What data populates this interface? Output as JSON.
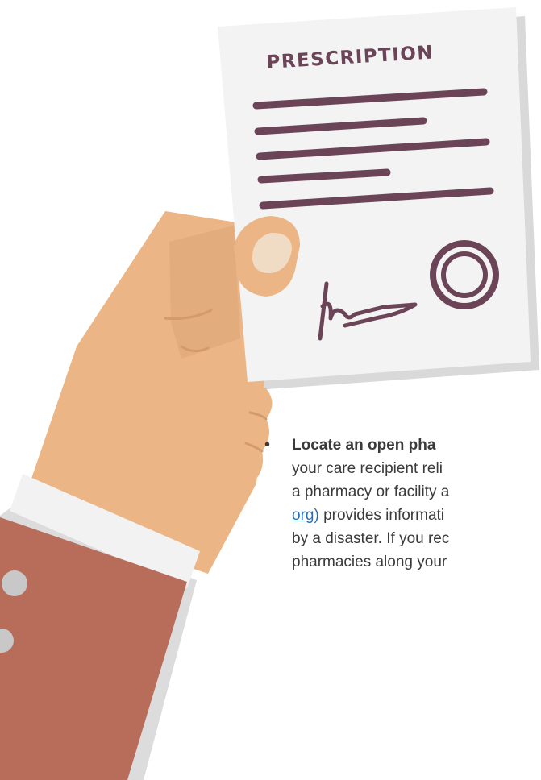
{
  "illustration": {
    "document_title": "PRESCRIPTION",
    "colors": {
      "paper": "#f3f3f3",
      "paper_shadow": "#d9d9d9",
      "ink": "#6b4557",
      "skin": "#ebb585",
      "skin_shade": "#dca474",
      "nail": "#f0dcc4",
      "cuff": "#f2f2f2",
      "sleeve": "#b86d5b",
      "button": "#c8c8c8"
    },
    "icons": [
      "hand",
      "prescription-paper",
      "signature",
      "stamp-seal"
    ]
  },
  "content": {
    "bullet": "•",
    "line1_bold": "Locate an open pha",
    "line2": "your care recipient reli",
    "line3": "a pharmacy or facility a",
    "line4_link": "org)",
    "line4_rest": " provides informati",
    "line5": "by a disaster. If you rec",
    "line6": "pharmacies along your"
  }
}
